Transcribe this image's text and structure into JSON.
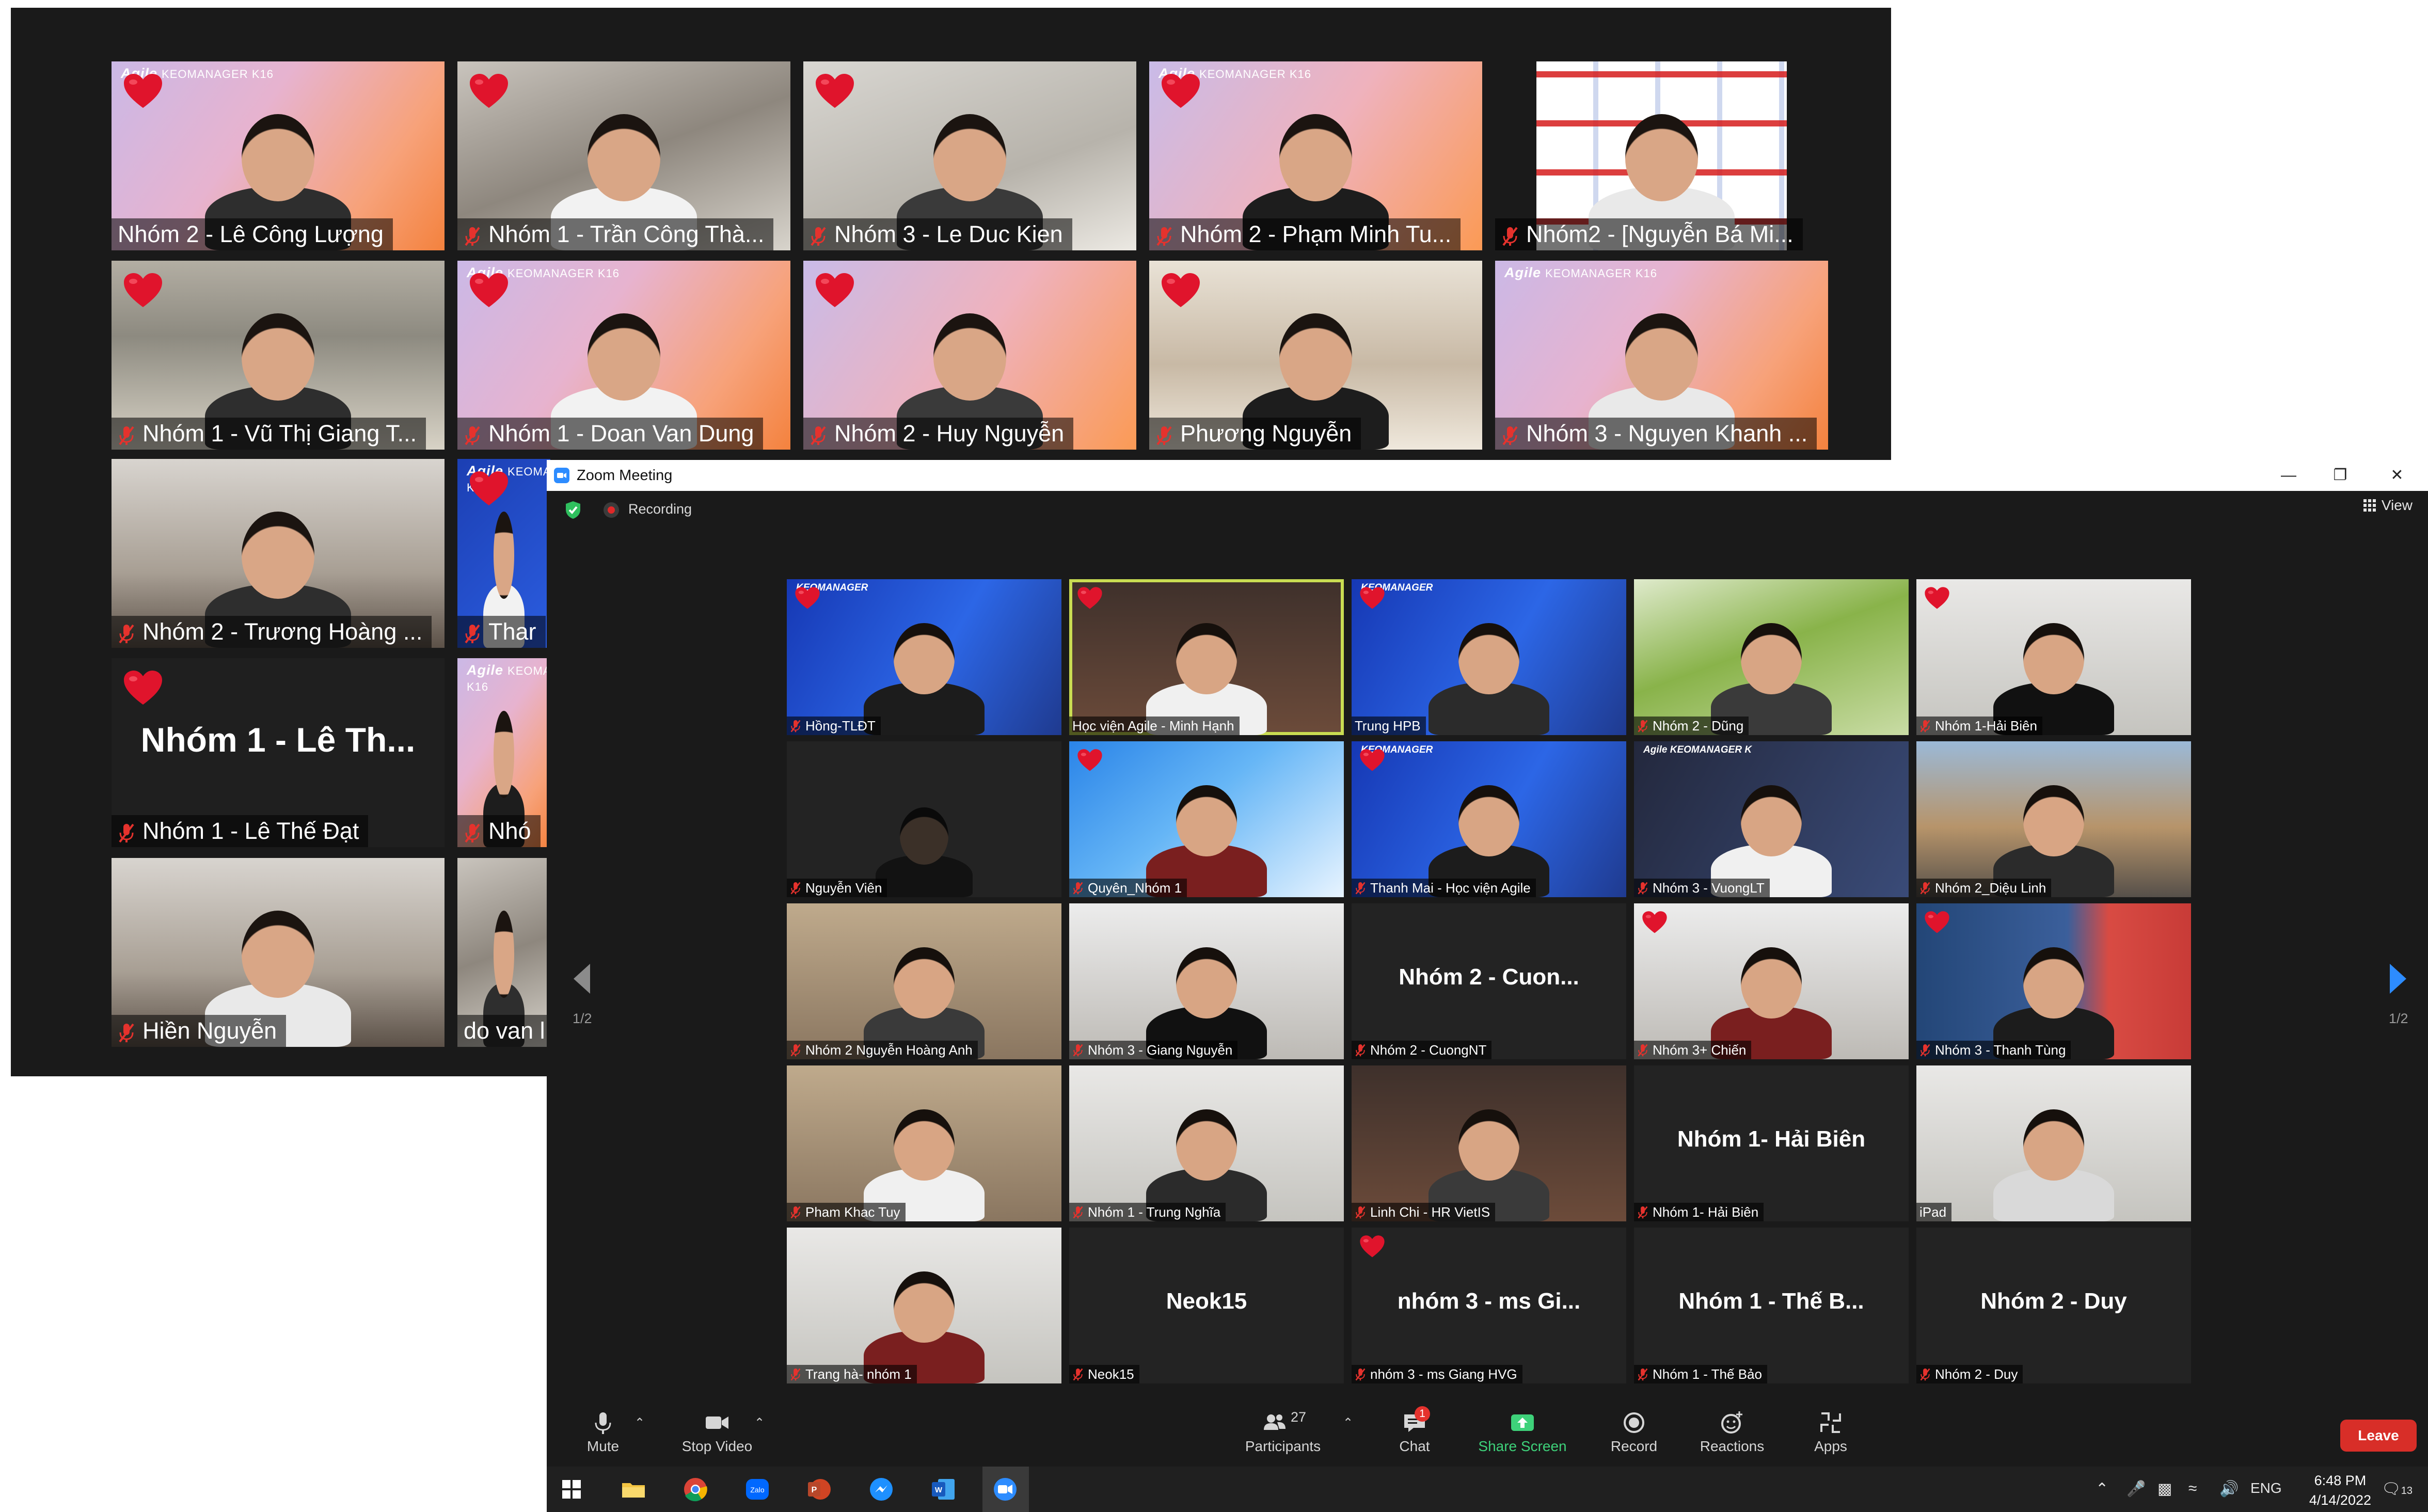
{
  "back_window": {
    "tiles": [
      {
        "name": "Nhóm 2  - Lê Công Lượng",
        "muted": false,
        "heart": true,
        "bg": "grad",
        "logo": true
      },
      {
        "name": "Nhóm 1 - Trần Công Thà...",
        "muted": true,
        "heart": true,
        "bg": "blur1",
        "logo": false
      },
      {
        "name": "Nhóm 3 - Le Duc Kien",
        "muted": true,
        "heart": true,
        "bg": "blur2",
        "logo": false
      },
      {
        "name": "Nhóm 2 - Phạm Minh Tu...",
        "muted": true,
        "heart": true,
        "bg": "grad2",
        "logo": true
      },
      {
        "name": "Nhóm2 - [Nguyễn Bá Mi...",
        "muted": true,
        "heart": false,
        "bg": "sponsor",
        "logo": false
      },
      {
        "name": "Nhóm 1 - Vũ Thị Giang T...",
        "muted": true,
        "heart": true,
        "bg": "office",
        "logo": false
      },
      {
        "name": "Nhóm 1 - Doan Van Dung",
        "muted": true,
        "heart": true,
        "bg": "grad",
        "logo": true
      },
      {
        "name": "Nhóm 2 - Huy Nguyễn",
        "muted": true,
        "heart": true,
        "bg": "grad2",
        "logo": false
      },
      {
        "name": "Phương Nguyễn",
        "muted": true,
        "heart": true,
        "bg": "books",
        "logo": false
      },
      {
        "name": "Nhóm 3 - Nguyen Khanh ...",
        "muted": true,
        "heart": false,
        "bg": "grad",
        "logo": true
      },
      {
        "name": "Nhóm 2 - Trương Hoàng ...",
        "muted": true,
        "heart": false,
        "bg": "wall",
        "logo": false
      },
      {
        "name": "Thar",
        "muted": true,
        "heart": true,
        "bg": "blue",
        "logo": true
      },
      {
        "name": "Nhóm 1 - Lê Thế Đạt",
        "muted": true,
        "heart": true,
        "bg": "dark",
        "logo": false,
        "big": "Nhóm 1 - Lê Th..."
      },
      {
        "name": "Nhó",
        "muted": true,
        "heart": false,
        "bg": "grad",
        "logo": true
      },
      {
        "name": "Hiền Nguyễn",
        "muted": true,
        "heart": false,
        "bg": "wall",
        "logo": false
      },
      {
        "name": "do van l",
        "muted": false,
        "heart": false,
        "bg": "blur1",
        "logo": false
      }
    ],
    "logo_text": "Agile",
    "logo_sub": "KEOMANAGER K16"
  },
  "zoom": {
    "title": "Zoom Meeting",
    "recording_label": "Recording",
    "view_label": "View",
    "page_indicator_left": "1/2",
    "page_indicator_right": "1/2",
    "tiles": [
      {
        "name": "Hồng-TLĐT",
        "muted": true,
        "heart": true,
        "bg": "keo",
        "logo": "KEOMANAGER"
      },
      {
        "name": "Học viện Agile - Minh Hạnh",
        "muted": false,
        "heart": true,
        "bg": "redwall",
        "active": true
      },
      {
        "name": "Trung HPB",
        "muted": false,
        "heart": true,
        "bg": "keo",
        "logo": "KEOMANAGER"
      },
      {
        "name": "Nhóm 2 - Dũng",
        "muted": true,
        "heart": false,
        "bg": "greenbg"
      },
      {
        "name": "Nhóm 1-Hải Biên",
        "muted": true,
        "heart": true,
        "bg": "whiteroom"
      },
      {
        "name": "Nguyễn Viên",
        "muted": true,
        "heart": false,
        "bg": "dark"
      },
      {
        "name": "Quyên_Nhóm 1",
        "muted": true,
        "heart": true,
        "bg": "bluehex"
      },
      {
        "name": "Thanh Mai - Học viện Agile",
        "muted": true,
        "heart": true,
        "bg": "keo",
        "logo": "KEOMANAGER"
      },
      {
        "name": "Nhóm 3 - VuongLT",
        "muted": true,
        "heart": false,
        "bg": "orange2",
        "logo": "Agile KEOMANAGER K"
      },
      {
        "name": "Nhóm 2_Diệu Linh",
        "muted": true,
        "heart": false,
        "bg": "bridge"
      },
      {
        "name": "Nhóm 2 Nguyễn Hoàng Anh",
        "muted": true,
        "heart": false,
        "bg": "room"
      },
      {
        "name": "Nhóm 3 - Giang Nguyễn",
        "muted": true,
        "heart": false,
        "bg": "bright"
      },
      {
        "name": "Nhóm 2 - CuongNT",
        "muted": true,
        "heart": false,
        "bg": "dark",
        "big": "Nhóm 2 - Cuon..."
      },
      {
        "name": "Nhóm 3+ Chiến",
        "muted": true,
        "heart": true,
        "bg": "bright"
      },
      {
        "name": "Nhóm 3 - Thanh Tùng",
        "muted": true,
        "heart": true,
        "bg": "sunset"
      },
      {
        "name": "Pham Khac Tuy",
        "muted": true,
        "heart": false,
        "bg": "room"
      },
      {
        "name": "Nhóm 1 - Trung Nghĩa",
        "muted": true,
        "heart": false,
        "bg": "whiteroom"
      },
      {
        "name": "Linh Chi - HR VietIS",
        "muted": true,
        "heart": false,
        "bg": "redwall"
      },
      {
        "name": "Nhóm 1- Hải Biên",
        "muted": true,
        "heart": false,
        "bg": "dark",
        "big": "Nhóm 1- Hải Biên"
      },
      {
        "name": "iPad",
        "muted": false,
        "heart": false,
        "bg": "whiteroom"
      },
      {
        "name": "Trang hà- nhóm 1",
        "muted": true,
        "heart": false,
        "bg": "whiteroom"
      },
      {
        "name": "Neok15",
        "muted": true,
        "heart": false,
        "bg": "dark",
        "big": "Neok15"
      },
      {
        "name": "nhóm 3 - ms Giang HVG",
        "muted": true,
        "heart": true,
        "bg": "dark",
        "big": "nhóm 3 - ms Gi..."
      },
      {
        "name": "Nhóm 1 - Thế Bảo",
        "muted": true,
        "heart": false,
        "bg": "dark",
        "big": "Nhóm 1 - Thế B..."
      },
      {
        "name": "Nhóm 2 - Duy",
        "muted": true,
        "heart": false,
        "bg": "dark",
        "big": "Nhóm 2 - Duy"
      }
    ],
    "toolbar": {
      "mute": "Mute",
      "stop_video": "Stop Video",
      "participants": "Participants",
      "participant_count": "27",
      "chat": "Chat",
      "chat_badge": "1",
      "share_screen": "Share Screen",
      "record": "Record",
      "reactions": "Reactions",
      "apps": "Apps",
      "leave": "Leave"
    }
  },
  "taskbar": {
    "language": "ENG",
    "time": "6:48 PM",
    "date": "4/14/2022",
    "notification_count": "13"
  },
  "colors": {
    "leave_red": "#d82e28",
    "share_green": "#3ed27a",
    "active_speaker": "#c9dc52",
    "heart_red": "#e0142c",
    "arrow_blue": "#2d8cff"
  }
}
